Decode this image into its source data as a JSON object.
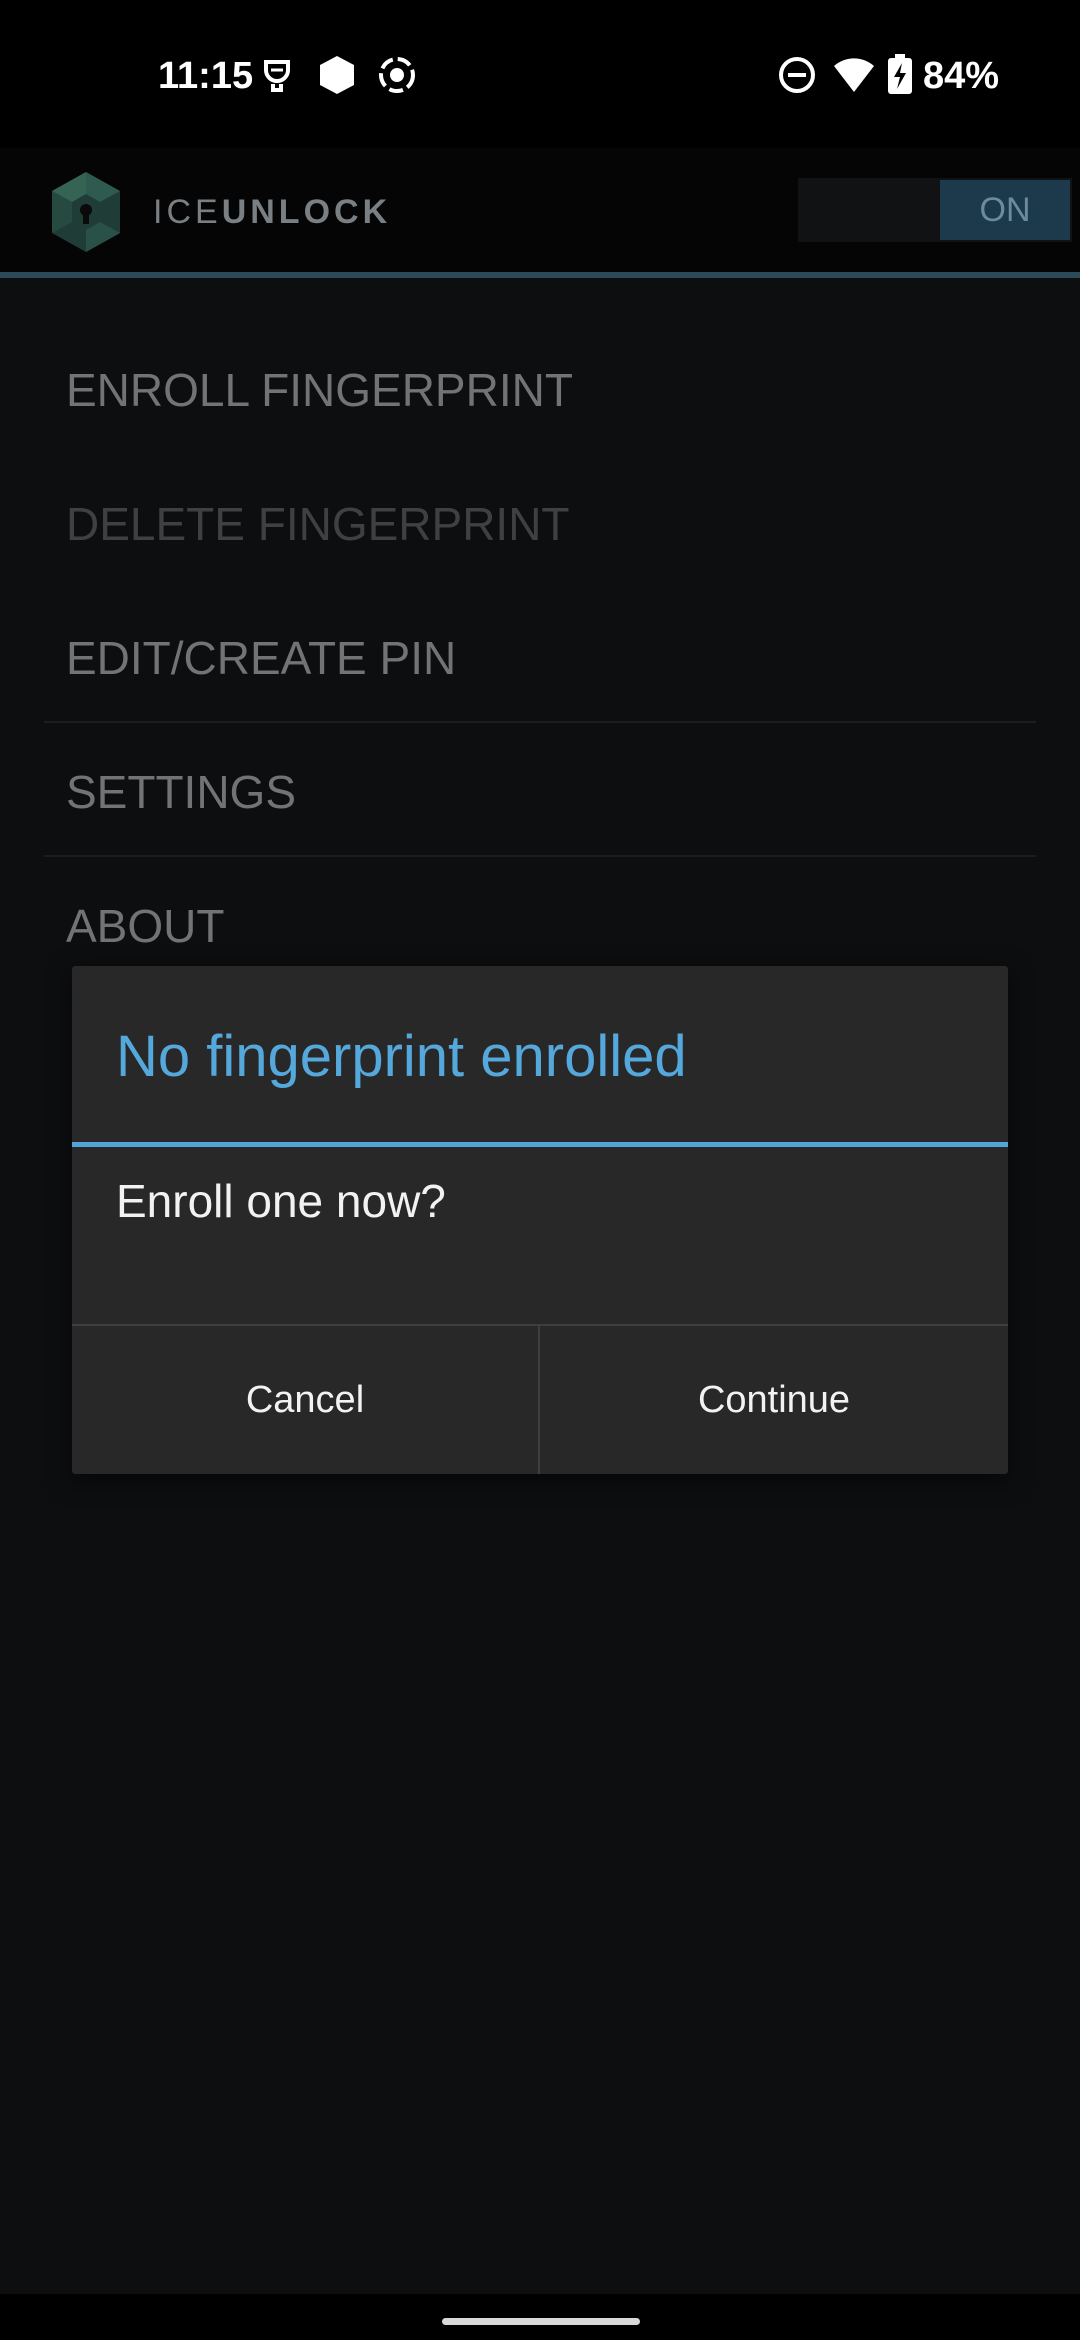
{
  "status_bar": {
    "time": "11:15",
    "battery_percent": "84%",
    "icons": [
      "assistant-icon",
      "hexagon-icon",
      "screen-record-icon",
      "do-not-disturb-icon",
      "wifi-icon",
      "battery-charging-icon"
    ]
  },
  "header": {
    "brand_part1": "ICE",
    "brand_part2": "UNLOCK",
    "toggle_label": "ON",
    "logo_icon": "ice-unlock-logo-icon"
  },
  "menu": {
    "items": [
      {
        "label": "ENROLL FINGERPRINT",
        "enabled": true
      },
      {
        "label": "DELETE FINGERPRINT",
        "enabled": false
      },
      {
        "label": "EDIT/CREATE PIN",
        "enabled": true
      },
      {
        "label": "SETTINGS",
        "enabled": true
      },
      {
        "label": "ABOUT",
        "enabled": true
      }
    ]
  },
  "dialog": {
    "title": "No fingerprint enrolled",
    "message": "Enroll one now?",
    "cancel_label": "Cancel",
    "continue_label": "Continue"
  },
  "colors": {
    "accent": "#55a8db",
    "dialog_bg": "#282828",
    "screen_bg": "#0d0e10"
  }
}
